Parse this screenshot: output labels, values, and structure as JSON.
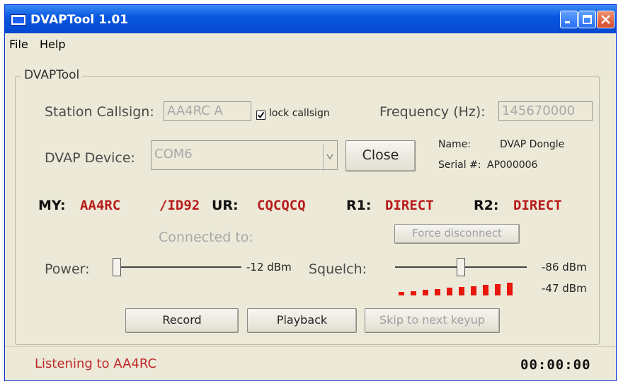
{
  "window": {
    "title": "DVAPTool 1.01"
  },
  "menu": {
    "file": "File",
    "help": "Help"
  },
  "group": {
    "label": "DVAPTool"
  },
  "station": {
    "callsign_label": "Station Callsign:",
    "callsign_value": "AA4RC  A",
    "lock_label": "lock callsign",
    "lock_checked": true,
    "frequency_label": "Frequency (Hz):",
    "frequency_value": "145670000"
  },
  "device": {
    "label": "DVAP Device:",
    "value": "COM6",
    "close_label": "Close",
    "name_label": "Name:",
    "name_value": "DVAP Dongle",
    "serial_label": "Serial #:",
    "serial_value": "AP000006"
  },
  "callsigns": {
    "my_label": "MY:",
    "my_value": "AA4RC",
    "my_suffix": "/ID92",
    "ur_label": "UR:",
    "ur_value": "CQCQCQ",
    "r1_label": "R1:",
    "r1_value": "DIRECT",
    "r2_label": "R2:",
    "r2_value": "DIRECT"
  },
  "connection": {
    "connected_label": "Connected to:",
    "force_disconnect_label": "Force disconnect"
  },
  "power": {
    "label": "Power:",
    "value_text": "-12 dBm",
    "level": 0.0
  },
  "squelch": {
    "label": "Squelch:",
    "value_text": "-86 dBm",
    "level": 0.5
  },
  "meter": {
    "value_text": "-47 dBm",
    "lit_segments": 10,
    "color": "#e8160c"
  },
  "buttons": {
    "record": "Record",
    "playback": "Playback",
    "skip": "Skip to next keyup"
  },
  "status": {
    "text": "Listening to AA4RC",
    "timer": "00:00:00"
  },
  "colors": {
    "accent": "#b81c1c",
    "titlebar": "#0a58e0"
  }
}
